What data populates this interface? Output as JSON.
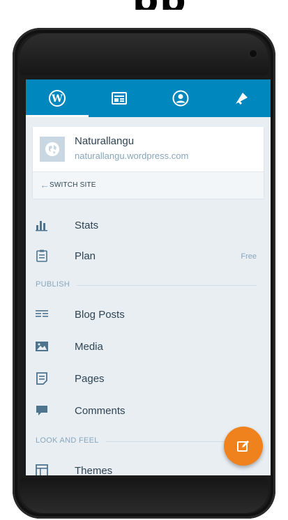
{
  "header_caption": "pp",
  "tabs": [
    {
      "id": "my-sites",
      "icon": "wordpress-icon",
      "active": true
    },
    {
      "id": "reader",
      "icon": "reader-icon",
      "active": false
    },
    {
      "id": "me",
      "icon": "profile-icon",
      "active": false
    },
    {
      "id": "notifications",
      "icon": "notifications-icon",
      "active": false
    }
  ],
  "site": {
    "name": "Naturallangu",
    "url": "naturallangu.wordpress.com",
    "icon": "globe-icon",
    "switch_label": "SWITCH SITE"
  },
  "menu": {
    "stats": {
      "label": "Stats",
      "icon": "stats-icon"
    },
    "plan": {
      "label": "Plan",
      "badge": "Free",
      "icon": "plan-icon"
    },
    "publish_section": "PUBLISH",
    "blog_posts": {
      "label": "Blog Posts",
      "icon": "posts-icon"
    },
    "media": {
      "label": "Media",
      "icon": "media-icon"
    },
    "pages": {
      "label": "Pages",
      "icon": "pages-icon"
    },
    "comments": {
      "label": "Comments",
      "icon": "comments-icon"
    },
    "look_section": "LOOK AND FEEL",
    "themes": {
      "label": "Themes",
      "icon": "themes-icon"
    }
  },
  "fab": {
    "icon": "edit-icon"
  },
  "colors": {
    "accent": "#0087be",
    "fab": "#f0821e",
    "text": "#2e4453",
    "muted": "#87a6bc",
    "background": "#e9eef3"
  }
}
